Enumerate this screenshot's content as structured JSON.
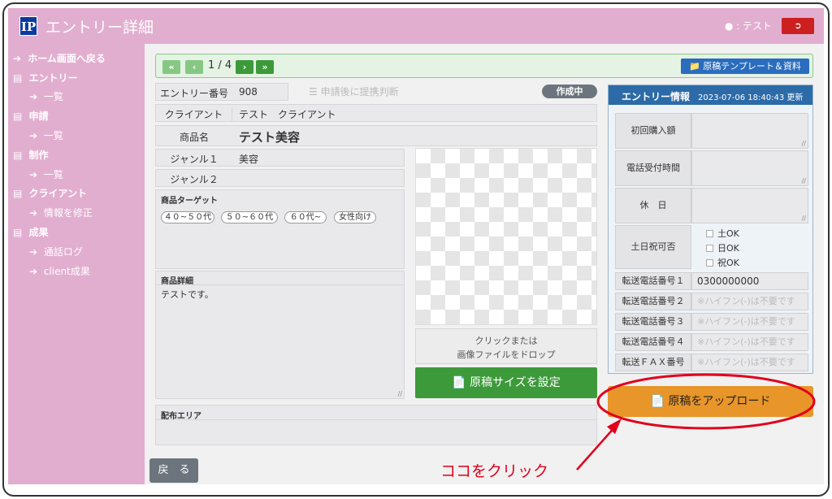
{
  "header": {
    "logo": "IP",
    "title": "エントリー詳細",
    "user": "テスト"
  },
  "sidebar": {
    "items": [
      {
        "label": "ホーム画面へ戻る",
        "bold": true,
        "icon": "arrow-circle-icon"
      },
      {
        "label": "エントリー",
        "bold": true,
        "icon": "list-icon"
      },
      {
        "label": "一覧",
        "bold": false,
        "icon": "arrow-circle-icon"
      },
      {
        "label": "申請",
        "bold": true,
        "icon": "list-icon"
      },
      {
        "label": "一覧",
        "bold": false,
        "icon": "arrow-circle-icon"
      },
      {
        "label": "制作",
        "bold": true,
        "icon": "list-icon"
      },
      {
        "label": "一覧",
        "bold": false,
        "icon": "arrow-circle-icon"
      },
      {
        "label": "クライアント",
        "bold": true,
        "icon": "list-icon"
      },
      {
        "label": "情報を修正",
        "bold": false,
        "icon": "arrow-circle-icon"
      },
      {
        "label": "成果",
        "bold": true,
        "icon": "list-icon"
      },
      {
        "label": "通話ログ",
        "bold": false,
        "icon": "arrow-circle-icon"
      },
      {
        "label": "client成果",
        "bold": false,
        "icon": "arrow-circle-icon"
      }
    ]
  },
  "pager": {
    "first": "«",
    "prev": "‹",
    "text": "1 / 4",
    "next": "›",
    "last": "»",
    "template_button": "原稿テンプレート＆資料"
  },
  "entry": {
    "number_label": "エントリー番号",
    "number": "908",
    "coin_note": "申請後に提携判断",
    "status": "作成中",
    "client_label": "クライアント",
    "client": "テスト　クライアント",
    "product_label": "商品名",
    "product": "テスト美容",
    "genre1_label": "ジャンル１",
    "genre1": "美容",
    "genre2_label": "ジャンル２",
    "genre2": "",
    "target_label": "商品ターゲット",
    "targets": [
      "４０~５０代",
      "５０~６０代",
      "６０代~",
      "女性向け"
    ],
    "detail_label": "商品詳細",
    "detail": "テストです。",
    "dist_label": "配布エリア"
  },
  "upload": {
    "drop_line1": "クリックまたは",
    "drop_line2": "画像ファイルをドロップ",
    "size_button": "原稿サイズを設定",
    "upload_button": "原稿をアップロード"
  },
  "info": {
    "title": "エントリー情報",
    "updated": "2023-07-06 18:40:43 更新",
    "first_amount": "初回購入額",
    "reception": "電話受付時間",
    "holiday": "休　日",
    "weekend": "土日祝可否",
    "checks": [
      "土OK",
      "日OK",
      "祝OK"
    ],
    "fwd1_label": "転送電話番号１",
    "fwd1": "0300000000",
    "fwd2_label": "転送電話番号２",
    "fwd3_label": "転送電話番号３",
    "fwd4_label": "転送電話番号４",
    "fax_label": "転送ＦＡＸ番号",
    "placeholder": "※ハイフン(-)は不要です"
  },
  "back_button": "戻　る",
  "annotation": "ココをクリック",
  "colors": {
    "header": "#e2aed0",
    "green": "#3d9a3a",
    "upload": "#e8952a",
    "red": "#e0001b",
    "info_header": "#2c6ba8"
  }
}
